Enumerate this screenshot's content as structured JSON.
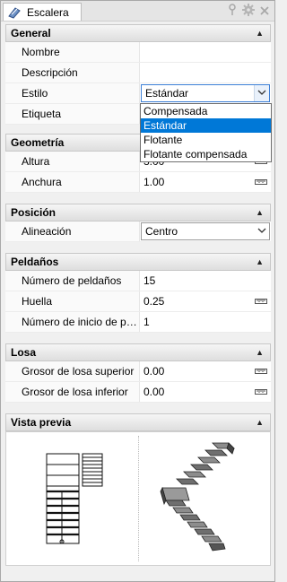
{
  "tab": {
    "label": "Escalera",
    "icon": "stair-tool-icon"
  },
  "tab_tools": {
    "pin": "pin-icon",
    "settings": "gear-icon",
    "close": "close-icon"
  },
  "sections": {
    "general": {
      "title": "General",
      "rows": {
        "nombre": {
          "label": "Nombre",
          "value": ""
        },
        "descripcion": {
          "label": "Descripción",
          "value": ""
        },
        "estilo": {
          "label": "Estilo",
          "value": "Estándar"
        },
        "etiqueta": {
          "label": "Etiqueta",
          "value": ""
        }
      }
    },
    "geometria": {
      "title": "Geometría",
      "rows": {
        "altura": {
          "label": "Altura",
          "value": "3.00"
        },
        "anchura": {
          "label": "Anchura",
          "value": "1.00"
        }
      }
    },
    "posicion": {
      "title": "Posición",
      "rows": {
        "alineacion": {
          "label": "Alineación",
          "value": "Centro"
        }
      }
    },
    "peldanos": {
      "title": "Peldaños",
      "rows": {
        "numero": {
          "label": "Número de peldaños",
          "value": "15"
        },
        "huella": {
          "label": "Huella",
          "value": "0.25"
        },
        "inicio": {
          "label": "Número de inicio de p…",
          "value": "1"
        }
      }
    },
    "losa": {
      "title": "Losa",
      "rows": {
        "superior": {
          "label": "Grosor de losa superior",
          "value": "0.00"
        },
        "inferior": {
          "label": "Grosor de losa inferior",
          "value": "0.00"
        }
      }
    },
    "vista": {
      "title": "Vista previa"
    }
  },
  "estilo_dropdown": {
    "options": [
      "Compensada",
      "Estándar",
      "Flotante",
      "Flotante compensada"
    ],
    "selected": "Estándar"
  },
  "colors": {
    "selection": "#0078d7",
    "header": "#e3e3e3",
    "focus_border": "#3c7fd6"
  }
}
